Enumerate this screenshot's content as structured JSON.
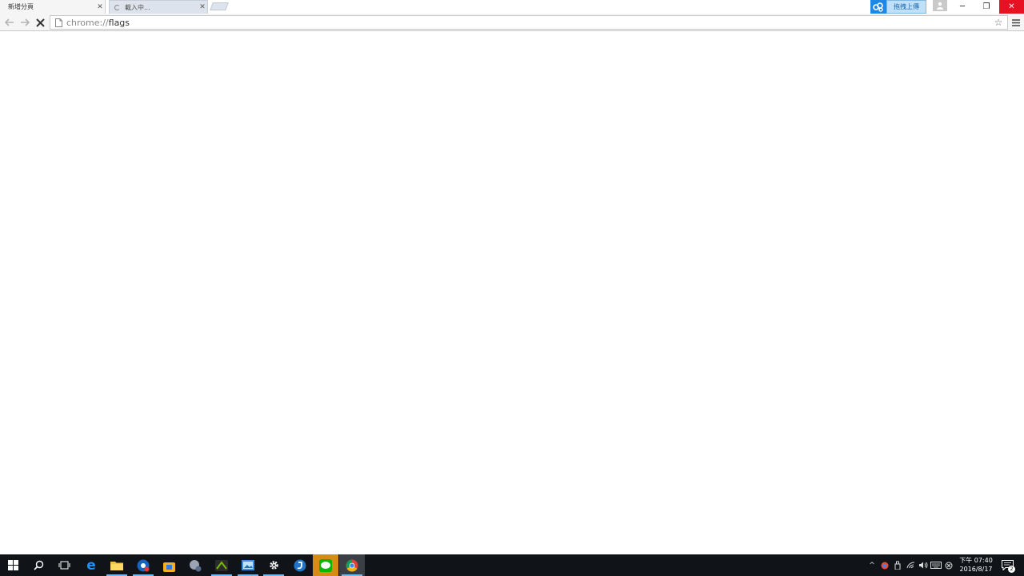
{
  "tabs": [
    {
      "label": "新增分頁",
      "active": true
    },
    {
      "label": "載入中...",
      "active": false
    }
  ],
  "extension": {
    "label": "拖拽上傳",
    "color": "#1e88e5"
  },
  "omnibox": {
    "scheme": "chrome://",
    "path": "flags"
  },
  "window_controls": {
    "minimize": "─",
    "restore": "❐",
    "close": "✕"
  },
  "taskbar": {
    "apps": [
      {
        "name": "start-icon"
      },
      {
        "name": "search-icon"
      },
      {
        "name": "task-view-icon"
      },
      {
        "name": "edge-icon"
      },
      {
        "name": "file-explorer-icon"
      },
      {
        "name": "chrome-canary-icon"
      },
      {
        "name": "store-icon"
      },
      {
        "name": "game-icon"
      },
      {
        "name": "nvidia-icon"
      },
      {
        "name": "photo-viewer-icon"
      },
      {
        "name": "settings-icon"
      },
      {
        "name": "app-blue-icon"
      },
      {
        "name": "line-icon"
      },
      {
        "name": "chrome-icon"
      }
    ],
    "clock": {
      "time": "下午 07:40",
      "date": "2016/8/17"
    },
    "notification_count": "2"
  }
}
